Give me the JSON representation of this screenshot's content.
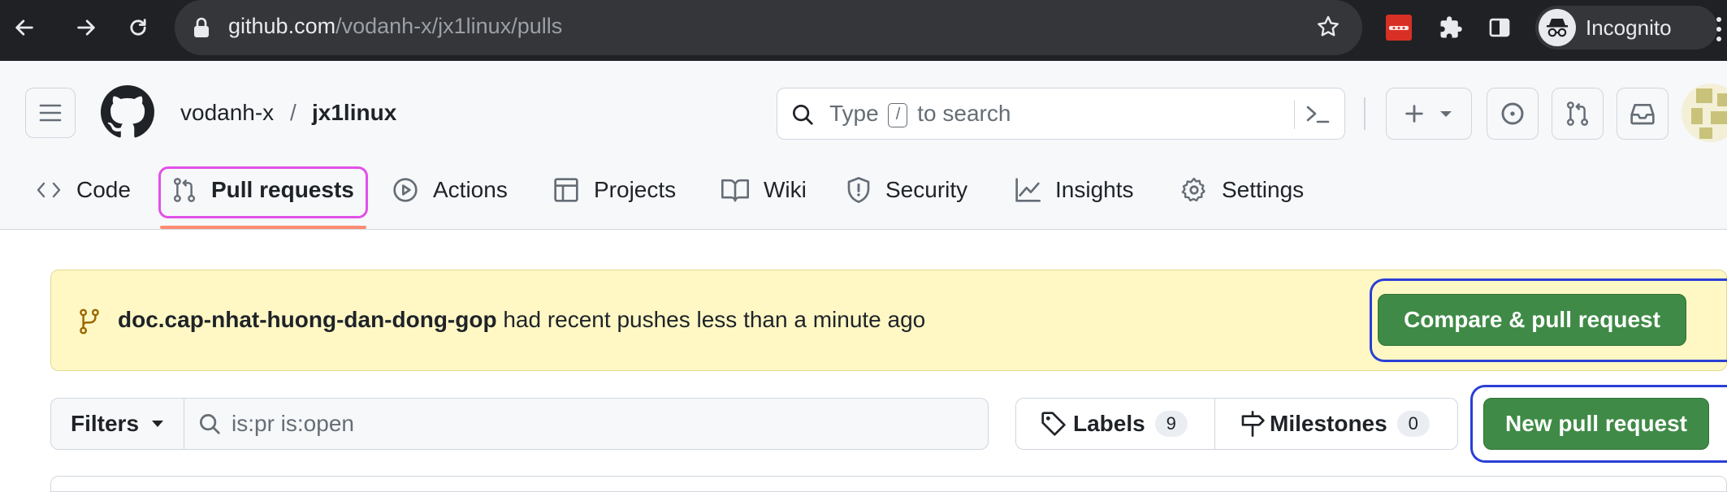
{
  "browser": {
    "url_host": "github.com",
    "url_path": "/vodanh-x/jx1linux/pulls",
    "incognito_label": "Incognito",
    "icons": [
      "back-arrow-icon",
      "forward-arrow-icon",
      "reload-icon",
      "lock-icon",
      "star-icon",
      "extension-red-icon",
      "puzzle-icon",
      "sidepanel-icon",
      "incognito-icon"
    ]
  },
  "header": {
    "owner": "vodanh-x",
    "separator": "/",
    "repo": "jx1linux",
    "search": {
      "type_label": "Type",
      "slash_key": "/",
      "to_search_label": "to search"
    }
  },
  "tabs": [
    {
      "label": "Code",
      "icon": "code-icon"
    },
    {
      "label": "Pull requests",
      "icon": "git-pull-request-icon",
      "active": true
    },
    {
      "label": "Actions",
      "icon": "play-icon"
    },
    {
      "label": "Projects",
      "icon": "table-icon"
    },
    {
      "label": "Wiki",
      "icon": "book-icon"
    },
    {
      "label": "Security",
      "icon": "shield-icon"
    },
    {
      "label": "Insights",
      "icon": "graph-icon"
    },
    {
      "label": "Settings",
      "icon": "gear-icon"
    }
  ],
  "banner": {
    "branch": "doc.cap-nhat-huong-dan-dong-gop",
    "message": " had recent pushes less than a minute ago",
    "compare_button": "Compare & pull request"
  },
  "filters": {
    "button_label": "Filters",
    "query": "is:pr is:open"
  },
  "labels": {
    "label": "Labels",
    "count": "9"
  },
  "milestones": {
    "label": "Milestones",
    "count": "0"
  },
  "new_pr_button": "New pull request",
  "colors": {
    "primary_green": "#3f8a46",
    "banner_bg": "#fff8c5",
    "active_underline": "#fd8c73",
    "highlight_magenta": "#e250e8",
    "highlight_blue": "#2a3fd6"
  }
}
